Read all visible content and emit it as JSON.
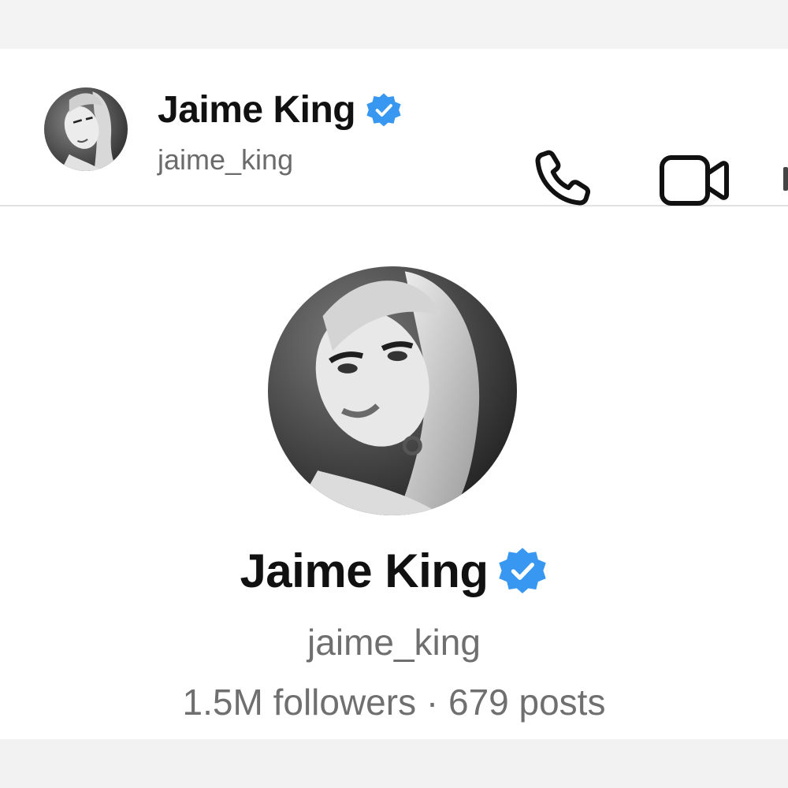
{
  "header": {
    "name": "Jaime King",
    "handle": "jaime_king",
    "verified": true
  },
  "profile": {
    "name": "Jaime King",
    "handle": "jaime_king",
    "verified": true,
    "followers": "1.5M followers",
    "separator": "·",
    "posts": "679 posts"
  },
  "icons": {
    "call": "phone-icon",
    "video": "video-camera-icon",
    "verified": "verified-badge-icon"
  },
  "colors": {
    "verified_badge": "#3897f0",
    "text_primary": "#111111",
    "text_secondary": "#6f6f6f",
    "divider": "#e2e2e2"
  }
}
